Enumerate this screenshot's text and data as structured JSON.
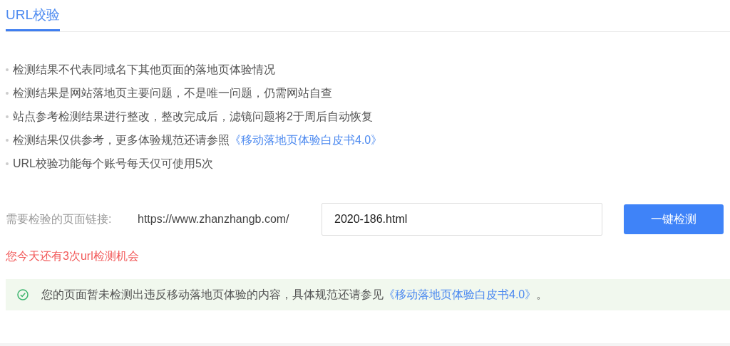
{
  "tabs": [
    {
      "label": "URL校验",
      "selected": true
    }
  ],
  "notes": [
    {
      "text": "检测结果不代表同域名下其他页面的落地页体验情况"
    },
    {
      "text": "检测结果是网站落地页主要问题，不是唯一问题，仍需网站自查"
    },
    {
      "text": "站点参考检测结果进行整改，整改完成后，滤镜问题将2于周后自动恢复"
    },
    {
      "text": "检测结果仅供参考，更多体验规范还请参照",
      "link": "《移动落地页体验白皮书4.0》"
    },
    {
      "text": "URL校验功能每个账号每天仅可使用5次"
    }
  ],
  "form": {
    "label": "需要检验的页面链接:",
    "prefix": "https://www.zhanzhangb.com/",
    "value": "2020-186.html",
    "button": "一键检测"
  },
  "remaining": "您今天还有3次url检测机会",
  "result": {
    "text": "您的页面暂未检测出违反移动落地页体验的内容，具体规范还请参见",
    "link": "《移动落地页体验白皮书4.0》",
    "end": "。"
  }
}
